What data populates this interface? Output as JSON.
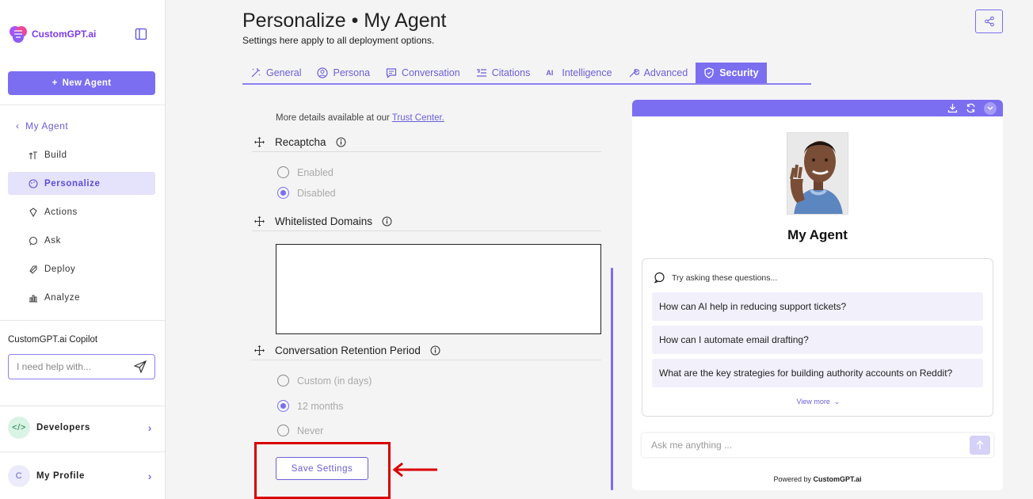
{
  "sidebar": {
    "brand": "CustomGPT.ai",
    "new_agent": "New Agent",
    "back_label": "My Agent",
    "items": [
      {
        "label": "Build",
        "icon": "build-icon"
      },
      {
        "label": "Personalize",
        "icon": "palette-icon",
        "active": true
      },
      {
        "label": "Actions",
        "icon": "actions-icon"
      },
      {
        "label": "Ask",
        "icon": "chat-icon"
      },
      {
        "label": "Deploy",
        "icon": "rocket-icon"
      },
      {
        "label": "Analyze",
        "icon": "chart-icon"
      }
    ],
    "copilot_title": "CustomGPT.ai Copilot",
    "copilot_placeholder": "I need help with...",
    "developers": "Developers",
    "profile": "My Profile",
    "profile_initial": "C"
  },
  "header": {
    "title": "Personalize • My Agent",
    "subtitle": "Settings here apply to all deployment options."
  },
  "tabs": [
    {
      "label": "General",
      "icon": "wand-icon"
    },
    {
      "label": "Persona",
      "icon": "user-circle-icon"
    },
    {
      "label": "Conversation",
      "icon": "message-icon"
    },
    {
      "label": "Citations",
      "icon": "quote-icon"
    },
    {
      "label": "Intelligence",
      "icon": "ai-icon"
    },
    {
      "label": "Advanced",
      "icon": "wrench-icon"
    },
    {
      "label": "Security",
      "icon": "shield-icon",
      "active": true
    }
  ],
  "security": {
    "note_prefix": "More details available at our ",
    "note_link": "Trust Center.",
    "recaptcha_title": "Recaptcha",
    "recaptcha_options": [
      "Enabled",
      "Disabled"
    ],
    "recaptcha_selected": "Disabled",
    "whitelist_title": "Whitelisted Domains",
    "whitelist_value": "",
    "retention_title": "Conversation Retention Period",
    "retention_options": [
      "Custom (in days)",
      "12 months",
      "Never"
    ],
    "retention_selected": "12 months",
    "save_label": "Save Settings"
  },
  "preview": {
    "agent_name": "My Agent",
    "questions_title": "Try asking these questions...",
    "questions": [
      "How can AI help in reducing support tickets?",
      "How can I automate email drafting?",
      "What are the key strategies for building authority accounts on Reddit?"
    ],
    "view_more": "View more",
    "ask_placeholder": "Ask me anything ...",
    "powered_prefix": "Powered by ",
    "powered_brand": "CustomGPT.ai"
  },
  "colors": {
    "accent": "#7b6ef0",
    "highlight": "#d90000"
  }
}
